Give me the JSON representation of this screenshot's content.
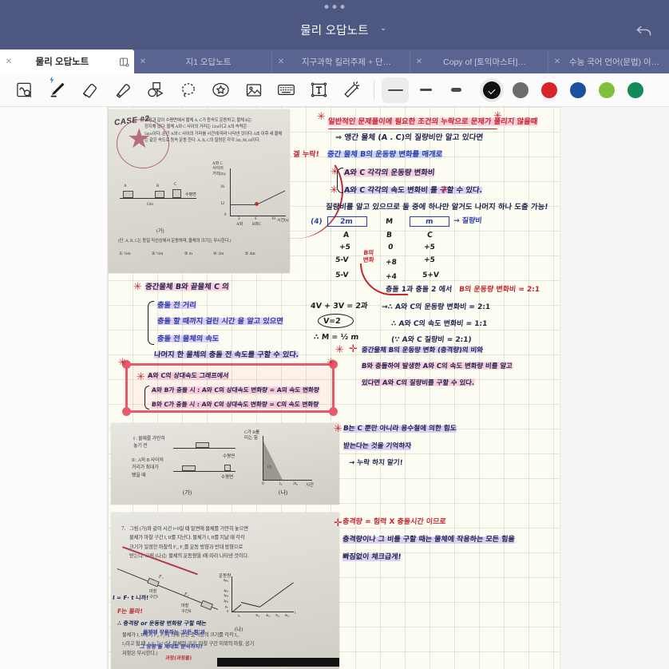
{
  "window": {
    "title": "물리 오답노트",
    "title_chevron": "⌄",
    "undo_icon": "undo-arrow-icon"
  },
  "tabs": [
    {
      "label": "물리 오답노트",
      "close": "✕",
      "active": true,
      "split_icon": "split-view-icon"
    },
    {
      "label": "지1 오답노트",
      "close": "✕",
      "active": false
    },
    {
      "label": "지구과학 킬러주제 + 단…",
      "close": "✕",
      "active": false
    },
    {
      "label": "Copy of [토익마스터]…",
      "close": "✕",
      "active": false
    },
    {
      "label": "수능 국어 언어(문법) 이…",
      "close": "✕",
      "active": false
    }
  ],
  "toolbar": {
    "tools": [
      {
        "name": "lasso-search-icon",
        "title": "읽기/검색"
      },
      {
        "name": "pen-icon",
        "title": "펜",
        "selected": true
      },
      {
        "name": "eraser-icon",
        "title": "지우개"
      },
      {
        "name": "highlighter-icon",
        "title": "형광펜"
      },
      {
        "name": "shapes-icon",
        "title": "도형"
      },
      {
        "name": "lasso-select-icon",
        "title": "올가미"
      },
      {
        "name": "sticker-icon",
        "title": "스티커"
      },
      {
        "name": "image-icon",
        "title": "이미지"
      },
      {
        "name": "keyboard-icon",
        "title": "키보드"
      },
      {
        "name": "text-box-icon",
        "title": "텍스트 상자"
      },
      {
        "name": "magic-wand-icon",
        "title": "매직 완드"
      }
    ],
    "widths": [
      {
        "name": "stroke-width-thin",
        "active": true
      },
      {
        "name": "stroke-width-medium",
        "active": false
      },
      {
        "name": "stroke-width-thick",
        "active": false
      }
    ],
    "colors": [
      {
        "name": "color-black",
        "hex": "#111111",
        "active": true
      },
      {
        "name": "color-gray",
        "hex": "#6d6d6d",
        "active": false
      },
      {
        "name": "color-red",
        "hex": "#d8232a",
        "active": false
      },
      {
        "name": "color-blue",
        "hex": "#18509f",
        "active": false
      },
      {
        "name": "color-light-green",
        "hex": "#7dc03a",
        "active": false
      },
      {
        "name": "color-green",
        "hex": "#138a5a",
        "active": false
      }
    ]
  },
  "page": {
    "photo_top": {
      "case_label": "CASE #2",
      "body": "그림과 같이 수평면에서 물체 A, C가 등속도 운동하고, 물체 B는\n정지해 있다. 물체 A와 C 사이의 거리는 12m이고 A의 속력은\n5m/s이다. 순간 A와 C 사이의 거리를 시간에 따라 나타낸 것이다. 6초 이후 세 물체\n는 같은 속도로 등속 운동 한다. A, B, C의 질량은 각각 2m, M, m이다.",
      "graph_ylabel": "A와 C\n사이의\n거리(m)",
      "graph_yticks": [
        "36",
        "12",
        "0"
      ],
      "graph_xticks": [
        "3",
        "6",
        "10"
      ],
      "graph_xlabel": "시간(s)",
      "graph_anno": [
        "A와 C 충돌",
        "(1)",
        "A와\n(2)",
        "B와 C"
      ],
      "caption": "(가)",
      "footer": "(단, A, B, C는 동일 직선상에서 운동하며, 물체의 크기는 무시한다.)",
      "choices": [
        "① 1/4 m",
        "② 1/2 m",
        "③ m",
        "④ 2m",
        "⑤ 4m"
      ]
    },
    "photo_mid": {
      "line1": "I : 물체를 가만히\n     놓기 전",
      "line2": "II : A와 B 사이의\n      거리가 최대가\n      됐을 때",
      "label_surface": "수평면",
      "caption_left": "(가)",
      "graph_ylabel": "C가 B를\n미는 힘",
      "graph_xticks": [
        "0",
        "t₀",
        "2t₀"
      ],
      "graph_xlabel": "시간",
      "graph_anno": "(J)",
      "caption_right": "(나)"
    },
    "photo_bottom": {
      "qnum": "7.",
      "body": "그림 (가)와 같이 시간 t=0일 때 밑면에 물체를 가만히 놓으면\n물체가 마찰 구간 I, II를 지난다. 물체가 I, II를 지날 때 각각\n크기가 일정한 마찰력 F₁, F₂를 운동 방향과 반대 방향으로\n받는다. 그림 (나)는 물체의 운동량을 t에 따라 나타낸 것이다.",
      "body2": "물체가 I, II에서 F₁, F₂에 의해 받은 충격량의 크기를 각각 I₁,\nI₂라고 할 때, I₂/I₁ 는? (단, 물체의 크기, 마찰 구간 이외의 마찰, 공기\n저항은 무시한다.)",
      "graph_ylabel": "운동량",
      "graph_yticks": [
        "6p₀",
        "4p₀",
        "3p₀",
        "2p₀",
        "p₀",
        "0"
      ],
      "graph_xticks": [
        "t₀",
        "3t₀",
        "4t₀",
        "5t₀",
        "6t₀",
        "t"
      ],
      "caption": "(나)",
      "label_F1": "F₁",
      "label_F2": "F₂",
      "label_region1": "마찰\n구간I",
      "label_region2": "마찰\n구간II",
      "hw_note1": "I = F· t 니까!",
      "hw_note2": "F는 몰라!",
      "hw_note3": "∴ 충격량 or 운동량 변화량 구할 때는",
      "hw_note4": "물체에 작용하는 '모든 힘'과",
      "hw_note5": "'그 방향'을 제대로 분석하자!",
      "hw_note6": "과정(과정을)"
    },
    "notes": [
      {
        "text": "일반적인 문제풀이에 필요한 조건의 누락으로 문제가 풀리지 않을때",
        "color": "red",
        "hl": "pink"
      },
      {
        "text": "⇒ 앵간 물체 (A . C)의 질량비만 알고 있다면",
        "color": "navy"
      },
      {
        "text": "겔 누락!",
        "color": "red"
      },
      {
        "text": "중간 물체 B의 운동량 변화를 매개로",
        "color": "blue",
        "hl": "blue"
      },
      {
        "text": "A와 C 각각의 운동량 변화비",
        "color": "navy",
        "hl": "pink"
      },
      {
        "text": "A와 C 각각의 속도 변화비 를 구할 수 있다.",
        "color": "navy",
        "hl": "purple"
      },
      {
        "text": "질량비를 알고 있으므로 둘 중에 하나만 알거도 나머지 하나 도출 가능!",
        "color": "navy"
      },
      {
        "text": "2m",
        "color": "blue"
      },
      {
        "text": "M",
        "color": "black"
      },
      {
        "text": "m",
        "color": "blue"
      },
      {
        "text": "→ 질량비",
        "color": "blue"
      },
      {
        "text": "A",
        "color": "black"
      },
      {
        "text": "B",
        "color": "black"
      },
      {
        "text": "C",
        "color": "black"
      },
      {
        "text": "+5",
        "color": "black"
      },
      {
        "text": "0",
        "color": "black"
      },
      {
        "text": "+5",
        "color": "black"
      },
      {
        "text": "5-V",
        "color": "black"
      },
      {
        "text": "+8",
        "color": "black"
      },
      {
        "text": "+5",
        "color": "black"
      },
      {
        "text": "5-V",
        "color": "black"
      },
      {
        "text": "+4",
        "color": "black"
      },
      {
        "text": "5+V",
        "color": "black"
      },
      {
        "text": "B의\n변화",
        "color": "red"
      },
      {
        "text": "충돌 1과 충돌 2 에서",
        "color": "navy"
      },
      {
        "text": "B의 운동량 변화비 = 2:1",
        "color": "red"
      },
      {
        "text": "4V + 3V = 2과",
        "color": "black"
      },
      {
        "text": "V=2",
        "color": "black"
      },
      {
        "text": "∴ M = ½ m",
        "color": "black"
      },
      {
        "text": "→∴ A와 C의 운동량 변화비 = 2:1",
        "color": "navy"
      },
      {
        "text": "∴ A와 C의 속도 변화비 = 1:1",
        "color": "navy"
      },
      {
        "text": "(∵ A와 C 질량비 = 2:1)",
        "color": "navy"
      },
      {
        "text": "중간물체 B와 끝물체 C 의",
        "color": "navy",
        "hl": "pink"
      },
      {
        "text": "충돌 전 거리",
        "color": "navy",
        "hl": "purple"
      },
      {
        "text": "충돌 할 때까지 걸린 시간 을 알고 있으면",
        "color": "navy",
        "hl": "purple"
      },
      {
        "text": "충돌 전 물체의 속도",
        "color": "navy",
        "hl": "purple"
      },
      {
        "text": "나머지 한 물체의 충돌 전 속도를 구할 수 있다.",
        "color": "navy",
        "hl": "purple"
      },
      {
        "text": "A와 C의 상대속도 그래프에서",
        "color": "navy",
        "hl": "pink"
      },
      {
        "text": "A와 B가 충돌 시 : A와 C의 상대속도 변화량 = A의 속도 변화량",
        "color": "navy",
        "hl": "pink"
      },
      {
        "text": "B와 C가 충돌 시 : A와 C의 상대속도 변화량 = C의 속도 변화량",
        "color": "navy",
        "hl": "pink"
      },
      {
        "text": "중간물체 B의 운동량 변화 (충격량)의 비와",
        "color": "navy",
        "hl": "purple"
      },
      {
        "text": "B와 충돌하여 발생한 A와 C의 속도 변화량 비를 알고",
        "color": "navy",
        "hl": "pink"
      },
      {
        "text": "있다면 A와 C의 질량비를 구할 수 있다.",
        "color": "navy",
        "hl": "pink"
      },
      {
        "text": "B는 C 뿐만 아니라 용수철에 의한 힘도",
        "color": "navy",
        "hl": "purple"
      },
      {
        "text": "받는다는 것을 기억하자",
        "color": "navy",
        "hl": "purple"
      },
      {
        "text": "→ 누락 하지 말기!",
        "color": "navy"
      },
      {
        "text": "충격량 = 힘력 X 충돌시간 이므로",
        "color": "red"
      },
      {
        "text": "충격량이나 그 비를 구할 때는 물체에 작용하는 모든 힘을",
        "color": "navy",
        "hl": "purple"
      },
      {
        "text": "빠짐없이 체크급게!",
        "color": "navy",
        "hl": "purple"
      }
    ],
    "selection": {
      "name": "selection-box",
      "corners": 4
    }
  }
}
